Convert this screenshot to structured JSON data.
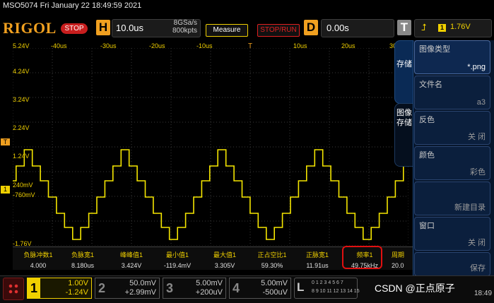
{
  "title": "MSO5074  Fri January 22 18:49:59 2021",
  "toolbar": {
    "logo": "RIGOL",
    "run_state": "STOP",
    "h_letter": "H",
    "timebase": "10.0us",
    "sample_rate": "8GSa/s",
    "memory_depth": "800kpts",
    "measure_label": "Measure",
    "stoprun_label": "STOP/RUN",
    "d_letter": "D",
    "delay": "0.00s",
    "t_letter": "T",
    "trigger_channel": "1",
    "trigger_level": "1.76V",
    "trigger_icon": "rising-edge-icon"
  },
  "grid": {
    "y_labels": [
      "5.24V",
      "4.24V",
      "3.24V",
      "2.24V",
      "1.24V",
      "240mV",
      "-760mV",
      "-1.76V"
    ],
    "x_labels": [
      "-40us",
      "-30us",
      "-20us",
      "-10us",
      "10us",
      "20us",
      "30"
    ],
    "ch1_marker": "1",
    "trigger_marker": "T",
    "trace_color": "#f5e600"
  },
  "measurements": [
    {
      "name": "负脉冲数1",
      "value": "4.000"
    },
    {
      "name": "负脉宽1",
      "value": "8.180us"
    },
    {
      "name": "峰峰值1",
      "value": "3.424V"
    },
    {
      "name": "最小值1",
      "value": "-119.4mV"
    },
    {
      "name": "最大值1",
      "value": "3.305V"
    },
    {
      "name": "正占空比1",
      "value": "59.30%"
    },
    {
      "name": "正脉宽1",
      "value": "11.91us"
    },
    {
      "name": "频率1",
      "value": "49.75kHz"
    },
    {
      "name": "周期",
      "value": "20.0"
    }
  ],
  "side_tabs": [
    {
      "label": "存储"
    },
    {
      "label": "图像存储"
    }
  ],
  "panel_items": [
    {
      "label": "图像类型",
      "value": "*.png"
    },
    {
      "label": "文件名",
      "value": "a3"
    },
    {
      "label": "反色",
      "value": "关 闭"
    },
    {
      "label": "颜色",
      "value": "彩色"
    },
    {
      "label": "",
      "value": "新建目录"
    },
    {
      "label": "窗口",
      "value": "关 闭"
    },
    {
      "label": "",
      "value": "保存"
    }
  ],
  "channels": [
    {
      "num": "1",
      "v1": "1.00V",
      "v2": "-1.24V",
      "color": "#f0d000",
      "active": true
    },
    {
      "num": "2",
      "v1": "50.0mV",
      "v2": "+2.99mV",
      "color": "#888",
      "active": false
    },
    {
      "num": "3",
      "v1": "5.00mV",
      "v2": "+200uV",
      "color": "#888",
      "active": false
    },
    {
      "num": "4",
      "v1": "5.00mV",
      "v2": "-500uV",
      "color": "#888",
      "active": false
    }
  ],
  "logic": {
    "letter": "L",
    "row1": "0 1 2 3 4 5 6 7",
    "row2": "8 9 10 11 12 13 14 15"
  },
  "watermark": "CSDN @正点原子",
  "clock": "18:49"
}
